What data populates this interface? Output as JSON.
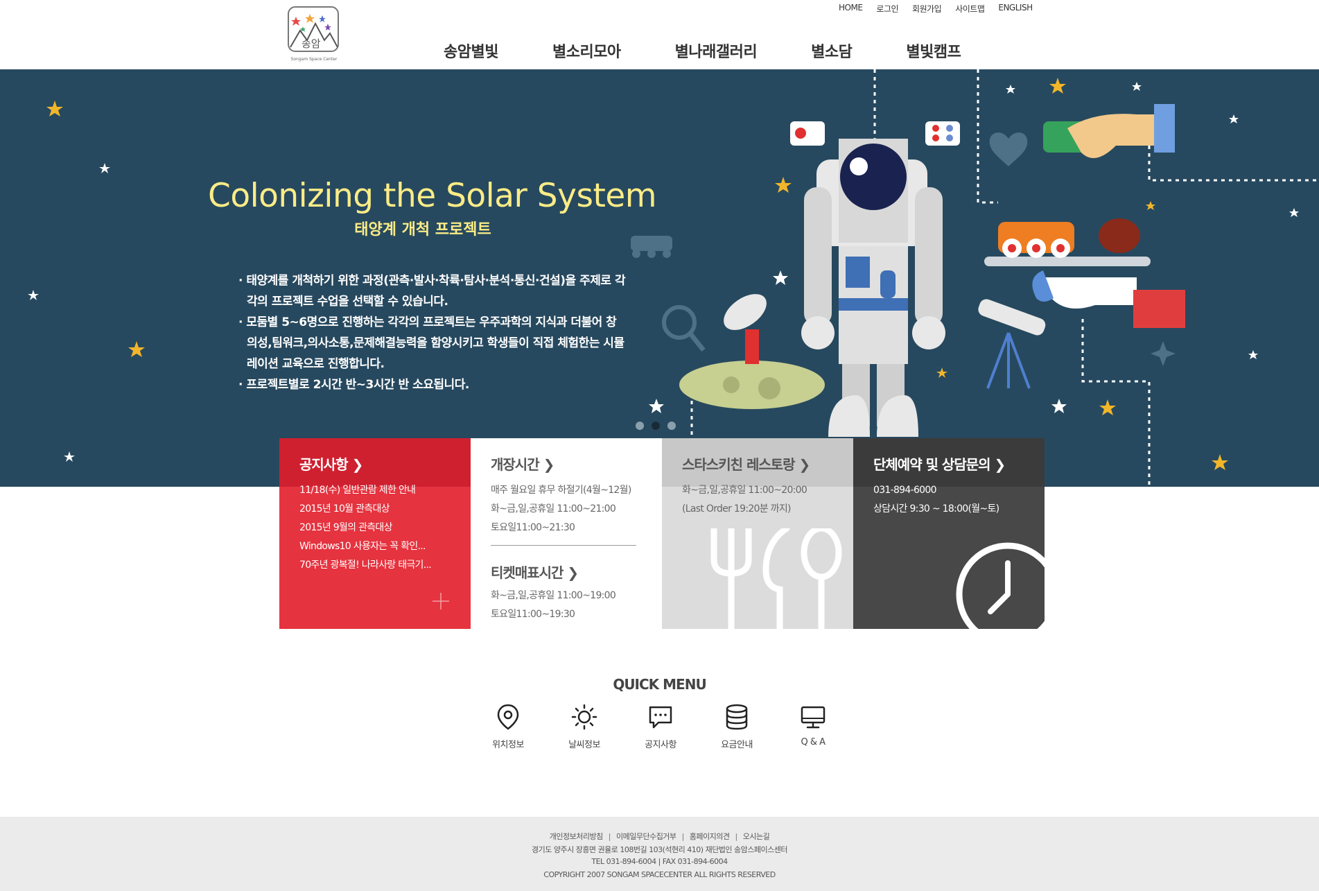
{
  "header": {
    "logo_text": "송암",
    "logo_subtext": "Songam Space Center",
    "util_links": [
      "HOME",
      "로그인",
      "회원가입",
      "사이트맵",
      "ENGLISH"
    ],
    "nav": [
      "송암별빛",
      "별소리모아",
      "별나래갤러리",
      "별소담",
      "별빛캠프"
    ]
  },
  "hero": {
    "title": "Colonizing the Solar System",
    "subtitle": "태양계 개척 프로젝트",
    "desc": [
      "· 태양계를 개척하기 위한 과정(관측·발사·착륙·탐사·분석·통신·건설)을 주제로 각각의 프로젝트 수업을 선택할 수 있습니다.",
      "· 모둠별 5~6명으로 진행하는 각각의 프로젝트는 우주과학의 지식과 더불어 창의성,팀워크,의사소통,문제해결능력을 함양시키고 학생들이 직접 체험한는 시뮬레이션 교육으로 진행합니다.",
      "· 프로젝트별로 2시간 반~3시간 반 소요됩니다."
    ],
    "slide_count": 3,
    "active_slide": 2
  },
  "boxes": {
    "notice": {
      "title": "공지사항 ❯",
      "items": [
        "11/18(수) 일반관람 제한 안내",
        "2015년 10월 관측대상",
        "2015년 9월의 관측대상",
        "Windows10 사용자는 꼭 확인...",
        "70주년 광복절! 나라사랑 태극기..."
      ],
      "more_icon": "plus-icon"
    },
    "hours": {
      "title": "개장시간 ❯",
      "items": [
        "매주 월요일 휴무 하절기(4월~12월)",
        "화~금,일,공휴일 11:00~21:00",
        "토요일11:00~21:30"
      ],
      "ticket_title": "티켓매표시간 ❯",
      "ticket_items": [
        "화~금,일,공휴일 11:00~19:00",
        "토요일11:00~19:30"
      ]
    },
    "restaurant": {
      "title": "스타스키친 레스토랑 ❯",
      "items": [
        "화~금,일,공휴일 11:00~20:00",
        "(Last Order 19:20분 까지)"
      ],
      "icon": "cutlery-icon"
    },
    "group": {
      "title": "단체예약 및 상담문의 ❯",
      "items": [
        "031-894-6000",
        "상담시간 9:30 ~ 18:00(월~토)"
      ],
      "icon": "clock-icon"
    }
  },
  "quick_menu": {
    "title": "QUICK MENU",
    "items": [
      {
        "label": "위치정보",
        "icon": "location-pin-icon"
      },
      {
        "label": "날씨정보",
        "icon": "sun-icon"
      },
      {
        "label": "공지사항",
        "icon": "chat-bubble-icon"
      },
      {
        "label": "요금안내",
        "icon": "coins-icon"
      },
      {
        "label": "Q & A",
        "icon": "monitor-icon"
      }
    ]
  },
  "footer": {
    "links": [
      "개인정보처리방침",
      "이메일무단수집거부",
      "홈페이지의견",
      "오시는길"
    ],
    "address": "경기도 양주시 장흥면 권율로 108번길 103(석현리 410) 재단법인 송암스페이스센터",
    "contact": "TEL 031-894-6004 | FAX 031-894-6004",
    "copyright": "COPYRIGHT 2007 SONGAM SPACECENTER ALL RIGHTS RESERVED"
  },
  "colors": {
    "hero_bg": "#27495f",
    "title_yellow": "#fbec86",
    "notice_red": "#e5333f",
    "restaurant_gray": "#dcdcdc",
    "group_dark": "#484848",
    "footer_bg": "#ebebeb"
  }
}
